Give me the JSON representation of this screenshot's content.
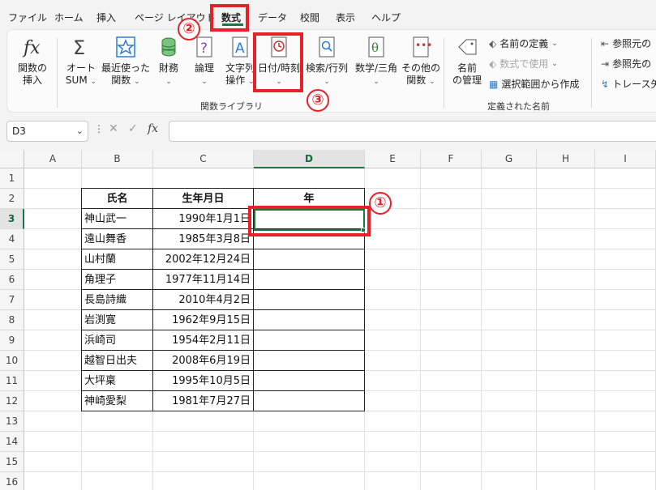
{
  "tabs": [
    {
      "label": "ファイル",
      "active": false
    },
    {
      "label": "ホーム",
      "active": false
    },
    {
      "label": "挿入",
      "active": false
    },
    {
      "label": "ページ レイアウト",
      "active": false
    },
    {
      "label": "数式",
      "active": true
    },
    {
      "label": "データ",
      "active": false
    },
    {
      "label": "校閲",
      "active": false
    },
    {
      "label": "表示",
      "active": false
    },
    {
      "label": "ヘルプ",
      "active": false
    }
  ],
  "ribbon": {
    "function_library": {
      "group_label": "関数ライブラリ",
      "insert_function": {
        "line1": "関数の",
        "line2": "挿入"
      },
      "autosum": {
        "line1": "オート",
        "line2": "SUM"
      },
      "recent": {
        "line1": "最近使った",
        "line2": "関数"
      },
      "financial": {
        "line1": "財務"
      },
      "logical": {
        "line1": "論理"
      },
      "text": {
        "line1": "文字列",
        "line2": "操作"
      },
      "datetime": {
        "line1": "日付/時刻"
      },
      "lookup": {
        "line1": "検索/行列"
      },
      "math": {
        "line1": "数学/三角"
      },
      "more": {
        "line1": "その他の",
        "line2": "関数"
      }
    },
    "defined_names": {
      "group_label": "定義された名前",
      "name_manager": {
        "line1": "名前",
        "line2": "の管理"
      },
      "define_name": "名前の定義",
      "use_in_formula": "数式で使用",
      "create_from_selection": "選択範囲から作成"
    },
    "auditing": {
      "trace_precedents": "参照元の",
      "trace_dependents": "参照先の",
      "remove_arrows": "トレース矢"
    }
  },
  "formula_bar": {
    "name_box": "D3",
    "fx_label": "fx",
    "formula": ""
  },
  "sheet": {
    "columns": [
      "A",
      "B",
      "C",
      "D",
      "E",
      "F",
      "G",
      "H",
      "I"
    ],
    "rows": [
      "1",
      "2",
      "3",
      "4",
      "5",
      "6",
      "7",
      "8",
      "9",
      "10",
      "11",
      "12",
      "13",
      "14",
      "15",
      "16"
    ],
    "headers": [
      "氏名",
      "生年月日",
      "年"
    ],
    "records": [
      {
        "name": "神山武一",
        "dob": "1990年1月1日",
        "year": ""
      },
      {
        "name": "遠山舞香",
        "dob": "1985年3月8日",
        "year": ""
      },
      {
        "name": "山村蘭",
        "dob": "2002年12月24日",
        "year": ""
      },
      {
        "name": "角理子",
        "dob": "1977年11月14日",
        "year": ""
      },
      {
        "name": "長島詩織",
        "dob": "2010年4月2日",
        "year": ""
      },
      {
        "name": "岩渕寛",
        "dob": "1962年9月15日",
        "year": ""
      },
      {
        "name": "浜崎司",
        "dob": "1954年2月11日",
        "year": ""
      },
      {
        "name": "越智日出夫",
        "dob": "2008年6月19日",
        "year": ""
      },
      {
        "name": "大坪稟",
        "dob": "1995年10月5日",
        "year": ""
      },
      {
        "name": "神崎愛梨",
        "dob": "1981年7月27日",
        "year": ""
      }
    ]
  },
  "annotations": {
    "step1": "①",
    "step2": "②",
    "step3": "③"
  },
  "colors": {
    "accent_green": "#107c41",
    "annotation_red": "#e8202a"
  }
}
